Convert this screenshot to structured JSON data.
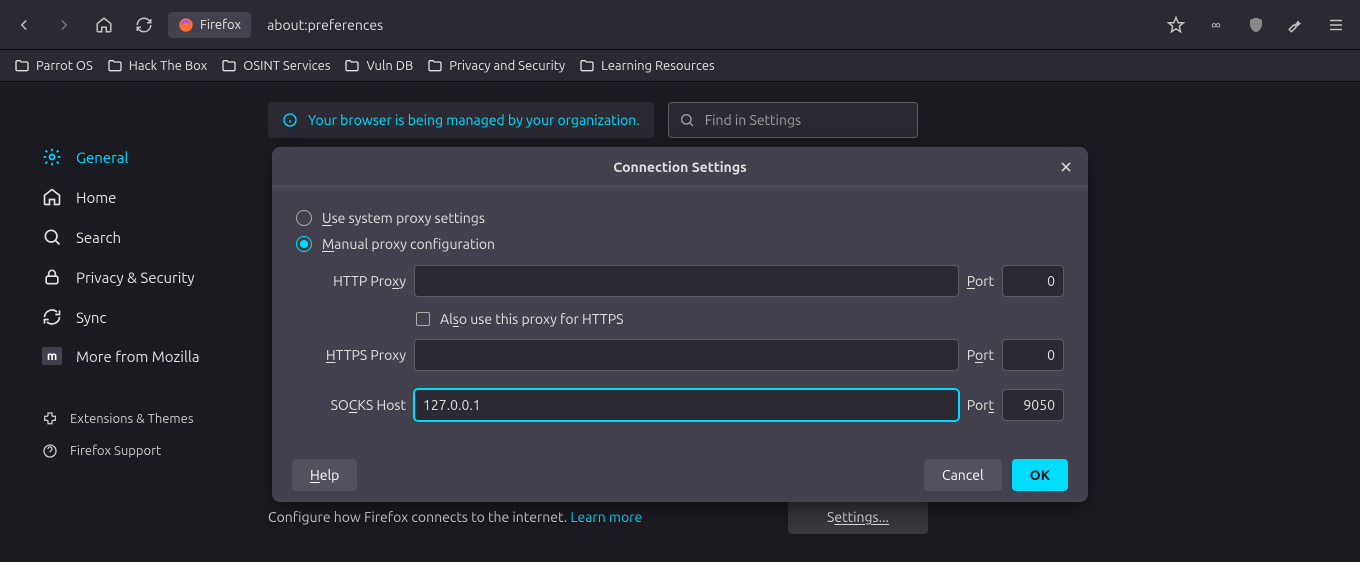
{
  "toolbar": {
    "tab_label": "Firefox",
    "url": "about:preferences"
  },
  "bookmarks": [
    "Parrot OS",
    "Hack The Box",
    "OSINT Services",
    "Vuln DB",
    "Privacy and Security",
    "Learning Resources"
  ],
  "info_bar": "Your browser is being managed by your organization.",
  "search_placeholder": "Find in Settings",
  "sidebar": {
    "items": [
      "General",
      "Home",
      "Search",
      "Privacy & Security",
      "Sync",
      "More from Mozilla"
    ],
    "extensions": "Extensions & Themes",
    "support": "Firefox Support"
  },
  "network": {
    "desc": "Configure how Firefox connects to the internet.  ",
    "learn": "Learn more",
    "settings_btn": "ettings..."
  },
  "dialog": {
    "title": "Connection Settings",
    "radio_system": "se system proxy settings",
    "radio_manual": "anual proxy configuration",
    "http_label_pre": "HTTP Pro",
    "http_label_post": "y",
    "also_https_pre": "Al",
    "also_https_post": "o use this proxy for HTTPS",
    "https_label": "TTPS Proxy",
    "socks_label_pre": "SO",
    "socks_label_post": "KS Host",
    "port_short": "ort",
    "port_t": "Por",
    "http_host": "",
    "http_port": "0",
    "https_host": "",
    "https_port": "0",
    "socks_host": "127.0.0.1",
    "socks_port": "9050",
    "help": "elp",
    "cancel": "Cancel",
    "ok": "OK"
  }
}
